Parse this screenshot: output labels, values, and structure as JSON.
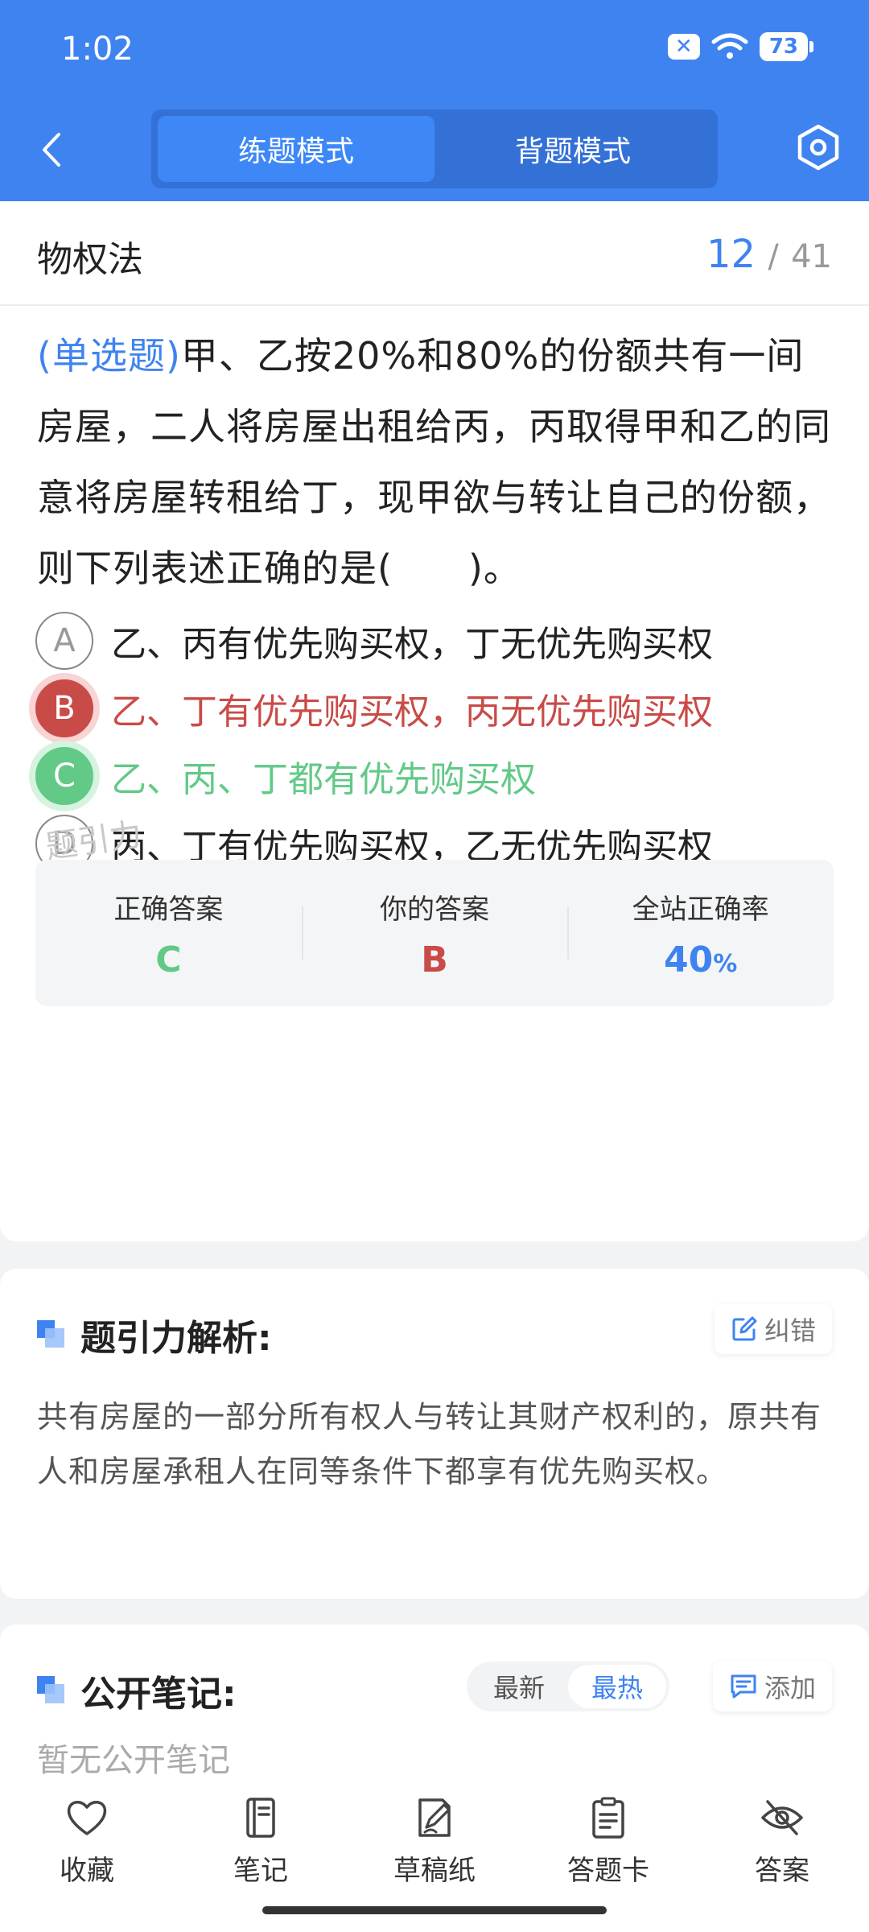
{
  "status_bar": {
    "time": "1:02",
    "battery": "73"
  },
  "header": {
    "modes": [
      {
        "label": "练题模式",
        "active": true
      },
      {
        "label": "背题模式",
        "active": false
      }
    ]
  },
  "subject": {
    "title": "物权法",
    "current": "12",
    "separator": "/",
    "total": "41"
  },
  "question": {
    "type_label": "(单选题)",
    "text": "甲、乙按20%和80%的份额共有一间房屋，二人将房屋出租给丙，丙取得甲和乙的同意将房屋转租给丁，现甲欲与转让自己的份额，则下列表述正确的是(　　)。",
    "options": [
      {
        "letter": "A",
        "text": "乙、丙有优先购买权，丁无优先购买权",
        "state": "normal"
      },
      {
        "letter": "B",
        "text": "乙、丁有优先购买权，丙无优先购买权",
        "state": "wrong"
      },
      {
        "letter": "C",
        "text": "乙、丙、丁都有优先购买权",
        "state": "correct"
      },
      {
        "letter": "D",
        "text": "丙、丁有优先购买权，乙无优先购买权",
        "state": "normal"
      }
    ]
  },
  "watermark": "题引力",
  "answer_summary": {
    "correct_label": "正确答案",
    "correct_value": "C",
    "yours_label": "你的答案",
    "yours_value": "B",
    "rate_label": "全站正确率",
    "rate_value": "40",
    "rate_unit": "%"
  },
  "analysis": {
    "title": "题引力解析:",
    "report_label": "纠错",
    "text": "共有房屋的一部分所有权人与转让其财产权利的，原共有人和房屋承租人在同等条件下都享有优先购买权。"
  },
  "notes": {
    "title": "公开笔记:",
    "sort_tabs": [
      {
        "label": "最新",
        "active": false
      },
      {
        "label": "最热",
        "active": true
      }
    ],
    "add_label": "添加",
    "empty_text": "暂无公开笔记"
  },
  "bottom_bar": {
    "items": [
      {
        "label": "收藏",
        "icon": "heart-icon"
      },
      {
        "label": "笔记",
        "icon": "notebook-icon"
      },
      {
        "label": "草稿纸",
        "icon": "draft-icon"
      },
      {
        "label": "答题卡",
        "icon": "clipboard-icon"
      },
      {
        "label": "答案",
        "icon": "eye-off-icon"
      }
    ]
  },
  "colors": {
    "primary": "#3f83f1",
    "wrong": "#c94b48",
    "correct": "#62c987"
  }
}
